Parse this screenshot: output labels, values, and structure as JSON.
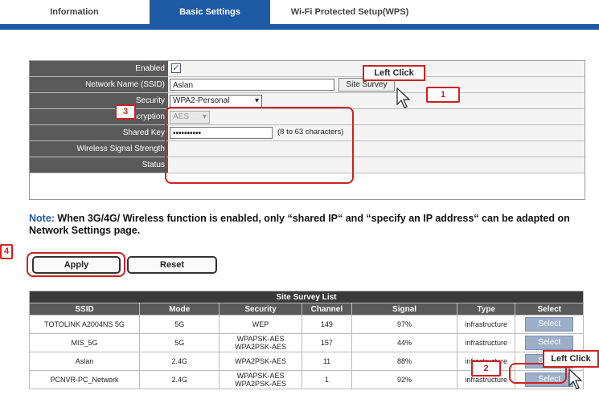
{
  "tabs": [
    {
      "label": "Information"
    },
    {
      "label": "Basic Settings"
    },
    {
      "label": "Wi-Fi Protected Setup(WPS)"
    }
  ],
  "form": {
    "enabled_label": "Enabled",
    "enabled_checked": true,
    "ssid_label": "Network Name (SSID)",
    "ssid_value": "Aslan",
    "site_survey_btn": "Site Survey",
    "security_label": "Security",
    "security_value": "WPA2-Personal",
    "encryption_label": "Encryption",
    "encryption_value": "AES",
    "shared_key_label": "Shared Key",
    "shared_key_value": "••••••••••",
    "shared_key_hint": "(8 to 63 characters)",
    "signal_label": "Wireless Signal Strength",
    "status_label": "Status"
  },
  "note": {
    "prefix": "Note:",
    "text": " When 3G/4G/ Wireless function is enabled, only “shared IP“ and “specify an IP address“ can be adapted on Network Settings page."
  },
  "buttons": {
    "apply": "Apply",
    "reset": "Reset"
  },
  "survey": {
    "title": "Site Survey List",
    "columns": [
      "SSID",
      "Mode",
      "Security",
      "Channel",
      "Signal",
      "Type",
      "Select"
    ],
    "rows": [
      {
        "ssid": "TOTOLINK A2004NS 5G",
        "mode": "5G",
        "security": "WEP",
        "channel": "149",
        "signal": "97%",
        "type": "infrastructure",
        "select": "Select"
      },
      {
        "ssid": "MIS_5G",
        "mode": "5G",
        "security": "WPAPSK-AES WPA2PSK-AES",
        "channel": "157",
        "signal": "44%",
        "type": "infrastructure",
        "select": "Select"
      },
      {
        "ssid": "Aslan",
        "mode": "2.4G",
        "security": "WPA2PSK-AES",
        "channel": "11",
        "signal": "88%",
        "type": "infrastructure",
        "select": "Select"
      },
      {
        "ssid": "PCNVR-PC_Network",
        "mode": "2.4G",
        "security": "WPAPSK-AES WPA2PSK-AES",
        "channel": "1",
        "signal": "92%",
        "type": "infrastructure",
        "select": "Select"
      }
    ]
  },
  "annotations": {
    "left_click_1": "Left Click",
    "left_click_2": "Left Click",
    "badge_1": "1",
    "badge_2": "2",
    "badge_3": "3",
    "badge_4": "4"
  },
  "colors": {
    "accent": "#1f5aa6",
    "annotation": "#cc2222",
    "label_bg": "#5a5a5a"
  }
}
